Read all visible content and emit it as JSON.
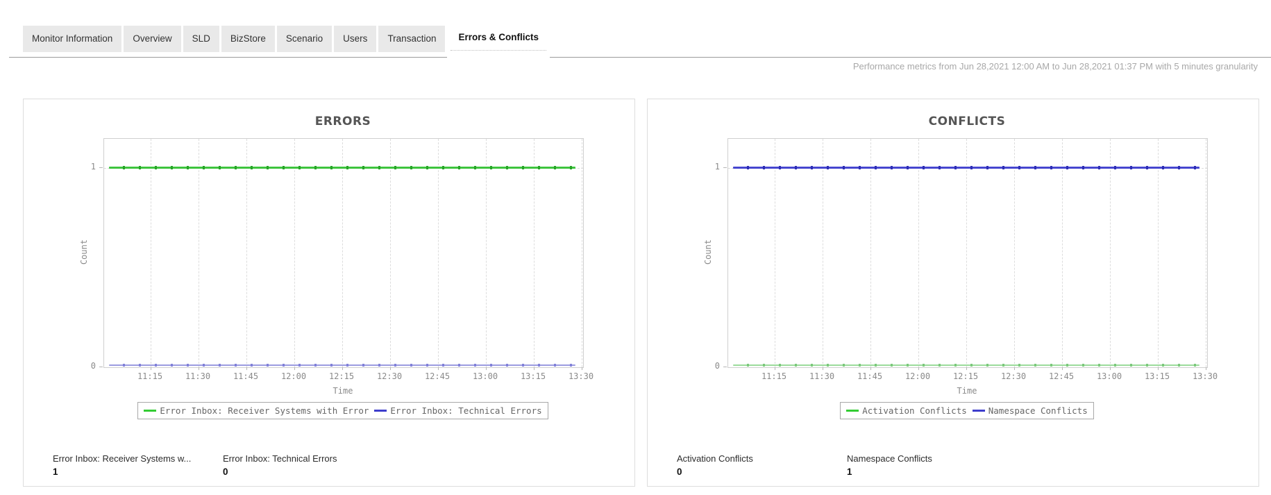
{
  "tab_bar": {
    "items": [
      {
        "label": "Monitor Information",
        "active": false
      },
      {
        "label": "Overview",
        "active": false
      },
      {
        "label": "SLD",
        "active": false
      },
      {
        "label": "BizStore",
        "active": false
      },
      {
        "label": "Scenario",
        "active": false
      },
      {
        "label": "Users",
        "active": false
      },
      {
        "label": "Transaction",
        "active": false
      },
      {
        "label": "Errors & Conflicts",
        "active": true
      }
    ]
  },
  "header": {
    "note": "Performance metrics from Jun 28,2021 12:00 AM to Jun 28,2021 01:37 PM with 5 minutes granularity"
  },
  "colors": {
    "green": "#33cc33",
    "blue": "#3d3dcc",
    "grid": "#dcdcdc",
    "axis_text": "#8a8a8a",
    "panel_border": "#dddddd",
    "legend_border": "#a8a8a8",
    "title_text": "#555555",
    "note_text": "#a8a8a8",
    "tab_bg": "#e9e9e9",
    "tab_rule": "#9b9b9b"
  },
  "chart_data": [
    {
      "type": "line",
      "title": "ERRORS",
      "x_axis": {
        "label": "Time",
        "ticks": [
          "11:15",
          "11:30",
          "11:45",
          "12:00",
          "12:15",
          "12:30",
          "12:45",
          "13:00",
          "13:15",
          "13:30"
        ],
        "start": "11:05",
        "end": "13:35",
        "interval_minutes": 5
      },
      "y_axis": {
        "label": "Count",
        "ticks": [
          "1",
          "0"
        ],
        "range": [
          0,
          1.15
        ]
      },
      "grid": {
        "vertical": "dashed",
        "horizontal": "dashed-at-1"
      },
      "legend_position": "bottom-center",
      "series": [
        {
          "name": "Error Inbox: Receiver Systems with Error",
          "legend_color": "#33cc33",
          "line_color": "#3ec43e",
          "marker_color": "#28a428",
          "value_constant": 1,
          "values": [
            1,
            1,
            1,
            1,
            1,
            1,
            1,
            1,
            1,
            1,
            1,
            1,
            1,
            1,
            1,
            1,
            1,
            1,
            1,
            1,
            1,
            1,
            1,
            1,
            1,
            1,
            1,
            1,
            1,
            1,
            1
          ]
        },
        {
          "name": "Error Inbox: Technical Errors",
          "legend_color": "#3d3dcc",
          "line_color": "#9b9be0",
          "marker_color": "#8181d8",
          "value_constant": 0,
          "values": [
            0,
            0,
            0,
            0,
            0,
            0,
            0,
            0,
            0,
            0,
            0,
            0,
            0,
            0,
            0,
            0,
            0,
            0,
            0,
            0,
            0,
            0,
            0,
            0,
            0,
            0,
            0,
            0,
            0,
            0,
            0
          ]
        }
      ],
      "stats": [
        {
          "label": "Error Inbox: Receiver Systems w...",
          "value": "1"
        },
        {
          "label": "Error Inbox: Technical Errors",
          "value": "0"
        }
      ]
    },
    {
      "type": "line",
      "title": "CONFLICTS",
      "x_axis": {
        "label": "Time",
        "ticks": [
          "11:15",
          "11:30",
          "11:45",
          "12:00",
          "12:15",
          "12:30",
          "12:45",
          "13:00",
          "13:15",
          "13:30"
        ],
        "start": "11:05",
        "end": "13:35",
        "interval_minutes": 5
      },
      "y_axis": {
        "label": "Count",
        "ticks": [
          "1",
          "0"
        ],
        "range": [
          0,
          1.15
        ]
      },
      "grid": {
        "vertical": "dashed",
        "horizontal": "dashed-at-1"
      },
      "legend_position": "bottom-center",
      "series": [
        {
          "name": "Activation Conflicts",
          "legend_color": "#33cc33",
          "line_color": "#9bdb9b",
          "marker_color": "#7cc87c",
          "value_constant": 0,
          "values": [
            0,
            0,
            0,
            0,
            0,
            0,
            0,
            0,
            0,
            0,
            0,
            0,
            0,
            0,
            0,
            0,
            0,
            0,
            0,
            0,
            0,
            0,
            0,
            0,
            0,
            0,
            0,
            0,
            0,
            0,
            0
          ]
        },
        {
          "name": "Namespace Conflicts",
          "legend_color": "#3d3dcc",
          "line_color": "#4646cf",
          "marker_color": "#2e2eb5",
          "value_constant": 1,
          "values": [
            1,
            1,
            1,
            1,
            1,
            1,
            1,
            1,
            1,
            1,
            1,
            1,
            1,
            1,
            1,
            1,
            1,
            1,
            1,
            1,
            1,
            1,
            1,
            1,
            1,
            1,
            1,
            1,
            1,
            1,
            1
          ]
        }
      ],
      "stats": [
        {
          "label": "Activation Conflicts",
          "value": "0"
        },
        {
          "label": "Namespace Conflicts",
          "value": "1"
        }
      ]
    }
  ]
}
